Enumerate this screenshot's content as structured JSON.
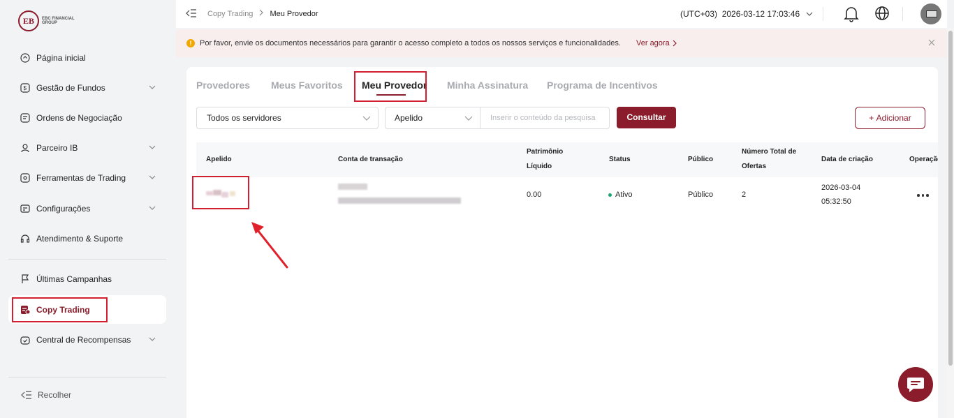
{
  "brand": {
    "logo_text": "EBC FINANCIAL GROUP",
    "accent": "#8a1c2b",
    "highlight": "#d32030"
  },
  "sidebar": {
    "items": [
      {
        "label": "Página inicial",
        "icon": "home-icon"
      },
      {
        "label": "Gestão de Fundos",
        "icon": "fund-icon",
        "expandable": true
      },
      {
        "label": "Ordens de Negociação",
        "icon": "orders-icon"
      },
      {
        "label": "Parceiro IB",
        "icon": "partner-icon",
        "expandable": true
      },
      {
        "label": "Ferramentas de Trading",
        "icon": "tools-icon",
        "expandable": true
      },
      {
        "label": "Configurações",
        "icon": "settings-icon",
        "expandable": true
      },
      {
        "label": "Atendimento & Suporte",
        "icon": "support-icon"
      },
      {
        "label": "Últimas Campanhas",
        "icon": "flag-icon"
      },
      {
        "label": "Copy Trading",
        "icon": "copy-trading-icon",
        "active": true
      },
      {
        "label": "Central de Recompensas",
        "icon": "rewards-icon",
        "expandable": true
      }
    ],
    "collapse_label": "Recolher"
  },
  "topbar": {
    "breadcrumb": [
      "Copy Trading",
      "Meu Provedor"
    ],
    "timezone": "(UTC+03)",
    "datetime": "2026-03-12 17:03:46"
  },
  "banner": {
    "text": "Por favor, envie os documentos necessários para garantir o acesso completo a todos os nossos serviços e funcionalidades.",
    "link": "Ver agora"
  },
  "tabs": [
    {
      "label": "Provedores",
      "active": false
    },
    {
      "label": "Meus Favoritos",
      "active": false
    },
    {
      "label": "Meu Provedor",
      "active": true
    },
    {
      "label": "Minha Assinatura",
      "active": false
    },
    {
      "label": "Programa de Incentivos",
      "active": false
    }
  ],
  "filters": {
    "server": "Todos os servidores",
    "field": "Apelido",
    "search_placeholder": "Inserir o conteúdo da pesquisa",
    "submit": "Consultar",
    "add": "Adicionar"
  },
  "table": {
    "headers": {
      "apelido": "Apelido",
      "conta": "Conta de transação",
      "patrimonio_1": "Patrimônio",
      "patrimonio_2": "Líquido",
      "status": "Status",
      "publico": "Público",
      "ofertas_1": "Número Total de",
      "ofertas_2": "Ofertas",
      "data": "Data de criação",
      "operacao": "Operação"
    },
    "rows": [
      {
        "patrimonio": "0.00",
        "status": "Ativo",
        "publico": "Público",
        "ofertas": "2",
        "data_1": "2026-03-04",
        "data_2": "05:32:50"
      }
    ]
  }
}
